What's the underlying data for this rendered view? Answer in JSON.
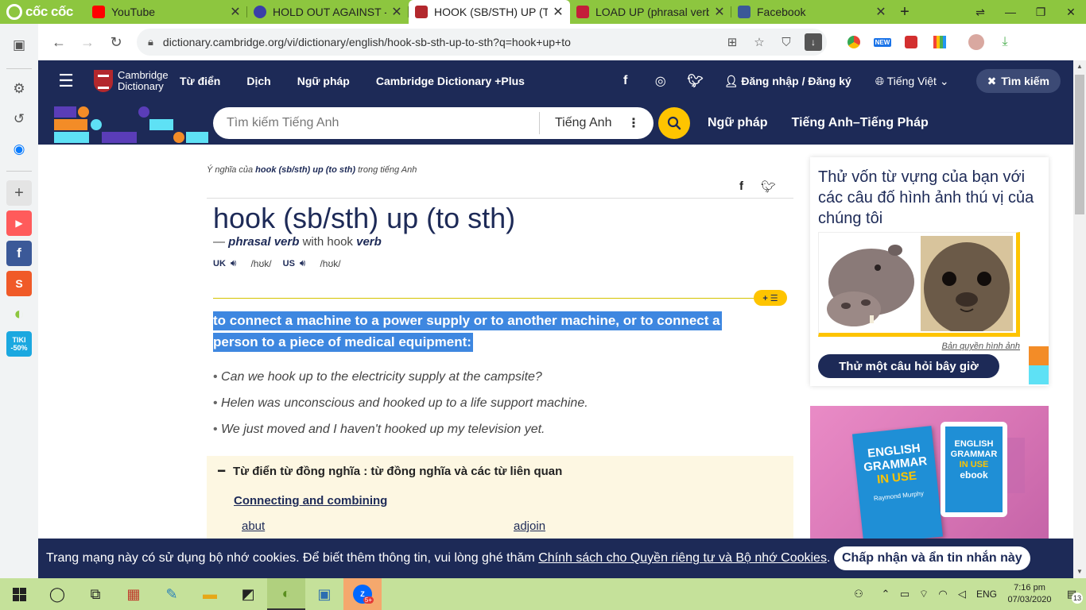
{
  "browser": {
    "brand": "cốc cốc",
    "tabs": [
      {
        "title": "YouTube",
        "favicon_color": "#ff0000",
        "active": false
      },
      {
        "title": "HOLD OUT AGAINST - Đ",
        "favicon_color": "#3a3fa8",
        "active": false
      },
      {
        "title": "HOOK (SB/STH) UP (TO",
        "favicon_color": "#b3282d",
        "active": true
      },
      {
        "title": "LOAD UP (phrasal verb)",
        "favicon_color": "#c41e3a",
        "active": false
      },
      {
        "title": "Facebook",
        "favicon_color": "#3b5998",
        "active": false
      }
    ],
    "new_tab": "+",
    "url": "dictionary.cambridge.org/vi/dictionary/english/hook-sb-sth-up-to-sth?q=hook+up+to",
    "ext_new_label": "NEW"
  },
  "header": {
    "logo_line1": "Cambridge",
    "logo_line2": "Dictionary",
    "nav": [
      "Từ điển",
      "Dịch",
      "Ngữ pháp",
      "Cambridge Dictionary +Plus"
    ],
    "login": "Đăng nhập / Đăng ký",
    "language": "Tiếng Việt",
    "search_button": "Tìm kiếm"
  },
  "search": {
    "placeholder": "Tìm kiếm Tiếng Anh",
    "dictionary": "Tiếng Anh",
    "links": [
      "Ngữ pháp",
      "Tiếng Anh–Tiếng Pháp"
    ]
  },
  "entry": {
    "breadcrumb_prefix": "Ý nghĩa của",
    "breadcrumb_word": "hook (sb/sth) up (to sth)",
    "breadcrumb_suffix": "trong tiếng Anh",
    "headword": "hook (sb/sth) up (to sth)",
    "pos_dash": "—",
    "pos": "phrasal verb",
    "pos_with": "with hook",
    "pos_verb": "verb",
    "uk_label": "UK",
    "uk_ipa": "/hʊk/",
    "us_label": "US",
    "us_ipa": "/hʊk/",
    "badge": "+ ☰",
    "definition": "to connect a machine to a power supply or to another machine, or to connect a person to a piece of medical equipment:",
    "examples": [
      "Can we hook up to the electricity supply at the campsite?",
      "Helen was unconscious and hooked up to a life support machine.",
      "We just moved and I haven't hooked up my television yet."
    ],
    "thesaurus_title": "Từ điển từ đồng nghĩa : từ đồng nghĩa và các từ liên quan",
    "thesaurus_group": "Connecting and combining",
    "thesaurus_words": [
      "abut",
      "adjoin"
    ]
  },
  "sidebar": {
    "quiz_title": "Thử vốn từ vựng của bạn với các câu đố hình ảnh thú vị của chúng tôi",
    "credit": "Bản quyền hình ảnh",
    "quiz_button": "Thử một câu hỏi bây giờ",
    "ad_title_1": "ENGLISH",
    "ad_title_2": "GRAMMAR",
    "ad_title_3": "IN USE",
    "ad_author": "Raymond Murphy",
    "ad_ebook": "ebook"
  },
  "cookie": {
    "text": "Trang mạng này có sử dụng bộ nhớ cookies. Để biết thêm thông tin, vui lòng ghé thăm",
    "link": "Chính sách cho Quyền riêng tư và Bộ nhớ Cookies",
    "period": ".",
    "button": "Chấp nhận và ẩn tin nhắn này"
  },
  "taskbar": {
    "lang": "ENG",
    "time": "7:16 pm",
    "date": "07/03/2020",
    "notif": "13",
    "badge": "5+"
  },
  "side_panel": {
    "tiki": "TIKI",
    "tiki_discount": "-50%"
  }
}
